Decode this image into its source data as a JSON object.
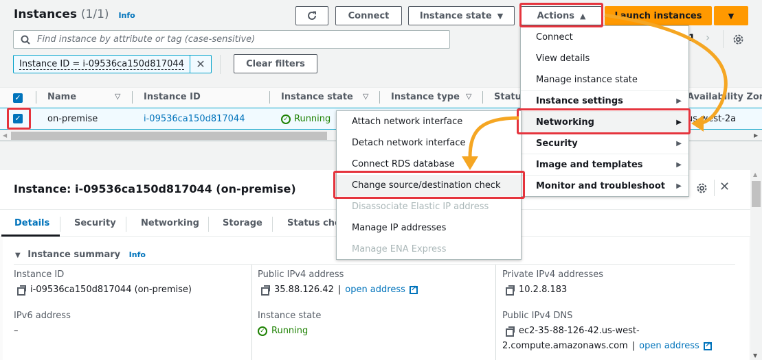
{
  "header": {
    "title": "Instances",
    "count": "(1/1)",
    "info": "Info"
  },
  "toolbar": {
    "refresh_icon": "refresh-icon",
    "connect": "Connect",
    "instance_state": "Instance state",
    "actions": "Actions",
    "launch": "Launch instances"
  },
  "search": {
    "placeholder": "Find instance by attribute or tag (case-sensitive)",
    "value": ""
  },
  "filter": {
    "token": "Instance ID = i-09536ca150d817044",
    "clear": "Clear filters"
  },
  "pagination": {
    "page": "1"
  },
  "table": {
    "columns": [
      "Name",
      "Instance ID",
      "Instance state",
      "Instance type",
      "Status",
      "Availability Zone"
    ],
    "rows": [
      {
        "selected": true,
        "name": "on-premise",
        "instance_id": "i-09536ca150d817044",
        "state": "Running",
        "az": "us-west-2a"
      }
    ]
  },
  "actions_menu": {
    "items": [
      {
        "label": "Connect",
        "submenu": false,
        "bold": false
      },
      {
        "label": "View details",
        "submenu": false,
        "bold": false
      },
      {
        "label": "Manage instance state",
        "submenu": false,
        "bold": false
      },
      {
        "label": "Instance settings",
        "submenu": true,
        "bold": true
      },
      {
        "label": "Networking",
        "submenu": true,
        "bold": true,
        "highlighted": true
      },
      {
        "label": "Security",
        "submenu": true,
        "bold": true
      },
      {
        "label": "Image and templates",
        "submenu": true,
        "bold": true
      },
      {
        "label": "Monitor and troubleshoot",
        "submenu": true,
        "bold": true
      }
    ]
  },
  "networking_submenu": {
    "items": [
      {
        "label": "Attach network interface",
        "disabled": false
      },
      {
        "label": "Detach network interface",
        "disabled": false
      },
      {
        "label": "Connect RDS database",
        "disabled": false
      },
      {
        "label": "Change source/destination check",
        "disabled": false,
        "highlighted": true
      },
      {
        "label": "Disassociate Elastic IP address",
        "disabled": true
      },
      {
        "label": "Manage IP addresses",
        "disabled": false
      },
      {
        "label": "Manage ENA Express",
        "disabled": true
      }
    ]
  },
  "details": {
    "title": "Instance: i-09536ca150d817044 (on-premise)",
    "tabs": [
      "Details",
      "Security",
      "Networking",
      "Storage",
      "Status checks"
    ],
    "active_tab": "Details",
    "section": "Instance summary",
    "section_info": "Info",
    "fields": {
      "instance_id": {
        "label": "Instance ID",
        "value": "i-09536ca150d817044 (on-premise)"
      },
      "public_ipv4": {
        "label": "Public IPv4 address",
        "value": "35.88.126.42",
        "link": "open address"
      },
      "private_ipv4": {
        "label": "Private IPv4 addresses",
        "value": "10.2.8.183"
      },
      "ipv6": {
        "label": "IPv6 address",
        "value": "–"
      },
      "instance_state": {
        "label": "Instance state",
        "value": "Running"
      },
      "public_dns": {
        "label": "Public IPv4 DNS",
        "value_line1": "ec2-35-88-126-42.us-west-",
        "value_line2": "2.compute.amazonaws.com",
        "link": "open address"
      }
    }
  },
  "colors": {
    "accent": "#0073bb",
    "primary_button": "#ff9900",
    "running": "#1d8102",
    "annotation_box": "#e5343d",
    "annotation_arrow": "#f5a623"
  }
}
